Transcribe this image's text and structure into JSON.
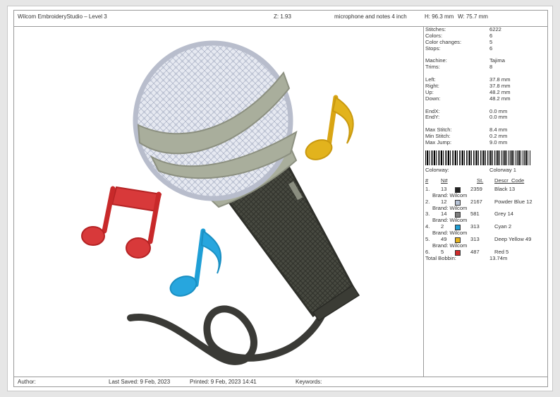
{
  "header": {
    "app_title": "Wilcom EmbroideryStudio – Level 3",
    "zoom": "Z: 1.93",
    "design_name": "microphone and notes 4 inch",
    "height": "H: 96.3 mm",
    "width": "W: 75.7 mm"
  },
  "stats": [
    {
      "label": "Stitches:",
      "value": "6222"
    },
    {
      "label": "Colors:",
      "value": "6"
    },
    {
      "label": "Color changes:",
      "value": "5"
    },
    {
      "label": "Stops:",
      "value": "6"
    }
  ],
  "machine": [
    {
      "label": "Machine:",
      "value": "Tajima"
    },
    {
      "label": "Trims:",
      "value": "8"
    }
  ],
  "extents": [
    {
      "label": "Left:",
      "value": "37.8 mm"
    },
    {
      "label": "Right:",
      "value": "37.8 mm"
    },
    {
      "label": "Up:",
      "value": "48.2 mm"
    },
    {
      "label": "Down:",
      "value": "48.2 mm"
    }
  ],
  "ends": [
    {
      "label": "EndX:",
      "value": "0.0 mm"
    },
    {
      "label": "EndY:",
      "value": "0.0 mm"
    }
  ],
  "limits": [
    {
      "label": "Max Stitch:",
      "value": "8.4 mm"
    },
    {
      "label": "Min Stitch:",
      "value": "0.2 mm"
    },
    {
      "label": "Max Jump:",
      "value": "9.0 mm"
    }
  ],
  "colorway": {
    "label": "Colorway:",
    "value": "Colorway 1"
  },
  "thread_table": {
    "headers": {
      "num": "#",
      "n": "N#",
      "st": "St.",
      "descr": "Descr_Code"
    },
    "rows": [
      {
        "idx": "1.",
        "n": "13",
        "color": "#222222",
        "st": "2359",
        "descr": "Black 13",
        "brand": "Brand: Wilcom"
      },
      {
        "idx": "2.",
        "n": "12",
        "color": "#b7c3d6",
        "st": "2167",
        "descr": "Powder Blue 12",
        "brand": "Brand: Wilcom"
      },
      {
        "idx": "3.",
        "n": "14",
        "color": "#7d7d7d",
        "st": "581",
        "descr": "Grey 14",
        "brand": "Brand: Wilcom"
      },
      {
        "idx": "4.",
        "n": "2",
        "color": "#1f9fd6",
        "st": "313",
        "descr": "Cyan 2",
        "brand": "Brand: Wilcom"
      },
      {
        "idx": "5.",
        "n": "49",
        "color": "#e4b21c",
        "st": "313",
        "descr": "Deep Yellow 49",
        "brand": "Brand: Wilcom"
      },
      {
        "idx": "6.",
        "n": "5",
        "color": "#d12a2a",
        "st": "487",
        "descr": "Red 5",
        "brand": ""
      }
    ],
    "total_label": "Total Bobbin:",
    "total_value": "13.74m"
  },
  "footer": {
    "author": "Author:",
    "last_saved": "Last Saved:  9 Feb, 2023",
    "printed": "Printed:  9 Feb, 2023 14:41",
    "keywords": "Keywords:"
  },
  "design_colors": {
    "cord": "#3a3a36",
    "handle": "#45473f",
    "band": "#a9ae9c",
    "grille": "#e2e5ee",
    "red_note": "#d8393a",
    "blue_note": "#27a6de",
    "yellow_note": "#e2b31d"
  }
}
